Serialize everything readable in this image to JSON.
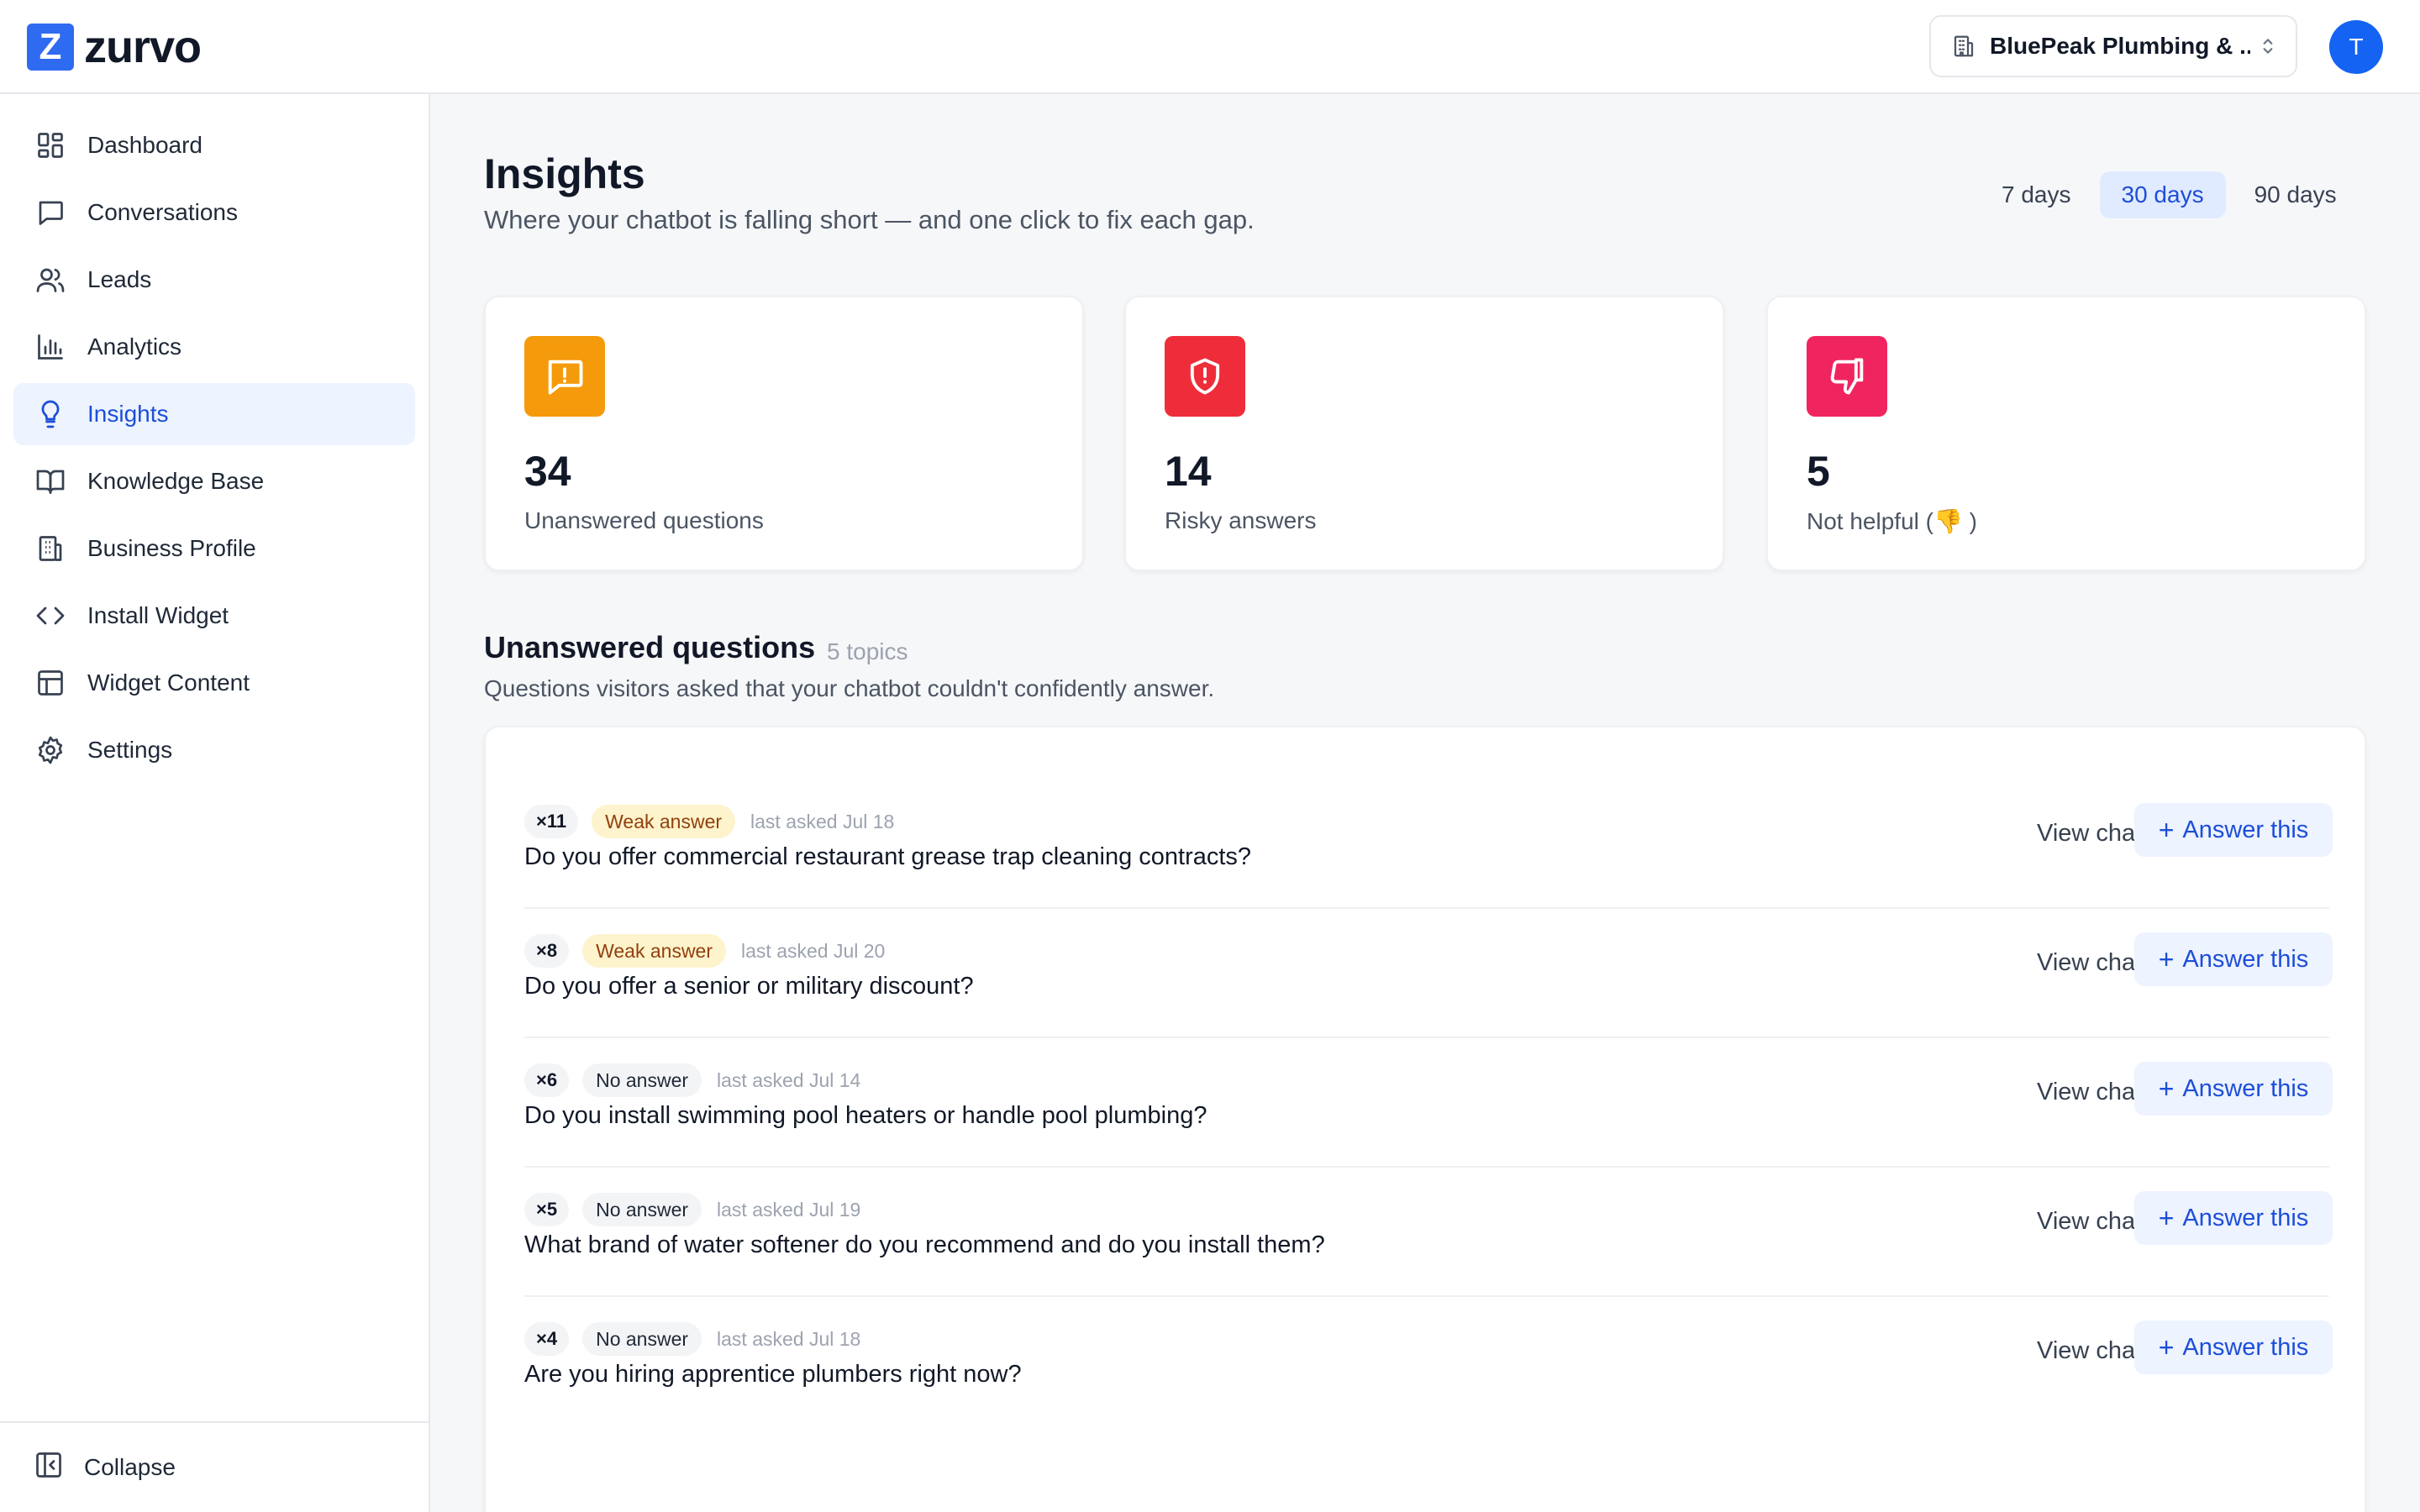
{
  "brand": {
    "logo_letter": "Z",
    "name": "zurvo",
    "color": "#2f6bf0"
  },
  "header": {
    "org_name": "BluePeak Plumbing & ...",
    "avatar_initial": "T"
  },
  "sidebar": {
    "items": [
      {
        "label": "Dashboard",
        "icon": "dashboard-icon"
      },
      {
        "label": "Conversations",
        "icon": "chat-bubble-icon"
      },
      {
        "label": "Leads",
        "icon": "users-icon"
      },
      {
        "label": "Analytics",
        "icon": "bar-chart-icon"
      },
      {
        "label": "Insights",
        "icon": "lightbulb-icon",
        "active": true
      },
      {
        "label": "Knowledge Base",
        "icon": "book-icon"
      },
      {
        "label": "Business Profile",
        "icon": "building-icon"
      },
      {
        "label": "Install Widget",
        "icon": "code-icon"
      },
      {
        "label": "Widget Content",
        "icon": "layout-icon"
      },
      {
        "label": "Settings",
        "icon": "gear-icon"
      }
    ],
    "collapse_label": "Collapse"
  },
  "page": {
    "title": "Insights",
    "subtitle": "Where your chatbot is falling short — and one click to fix each gap.",
    "ranges": [
      "7 days",
      "30 days",
      "90 days"
    ],
    "active_range": "30 days"
  },
  "stats": [
    {
      "value": "34",
      "label": "Unanswered questions",
      "icon": "alert-message-icon",
      "color": "#f59a0b"
    },
    {
      "value": "14",
      "label": "Risky answers",
      "icon": "shield-alert-icon",
      "color": "#ef2d3a"
    },
    {
      "value": "5",
      "label": "Not helpful (👎 )",
      "icon": "thumbs-down-icon",
      "color": "#f0245e"
    }
  ],
  "unanswered": {
    "title": "Unanswered questions",
    "count_label": "5 topics",
    "description": "Questions visitors asked that your chatbot couldn't confidently answer.",
    "view_label": "View chat",
    "answer_label": "Answer this",
    "rows": [
      {
        "count": "×11",
        "status": "Weak answer",
        "asked": "last asked Jul 18",
        "question": "Do you offer commercial restaurant grease trap cleaning contracts?"
      },
      {
        "count": "×8",
        "status": "Weak answer",
        "asked": "last asked Jul 20",
        "question": "Do you offer a senior or military discount?"
      },
      {
        "count": "×6",
        "status": "No answer",
        "asked": "last asked Jul 14",
        "question": "Do you install swimming pool heaters or handle pool plumbing?"
      },
      {
        "count": "×5",
        "status": "No answer",
        "asked": "last asked Jul 19",
        "question": "What brand of water softener do you recommend and do you install them?"
      },
      {
        "count": "×4",
        "status": "No answer",
        "asked": "last asked Jul 18",
        "question": "Are you hiring apprentice plumbers right now?"
      }
    ]
  }
}
